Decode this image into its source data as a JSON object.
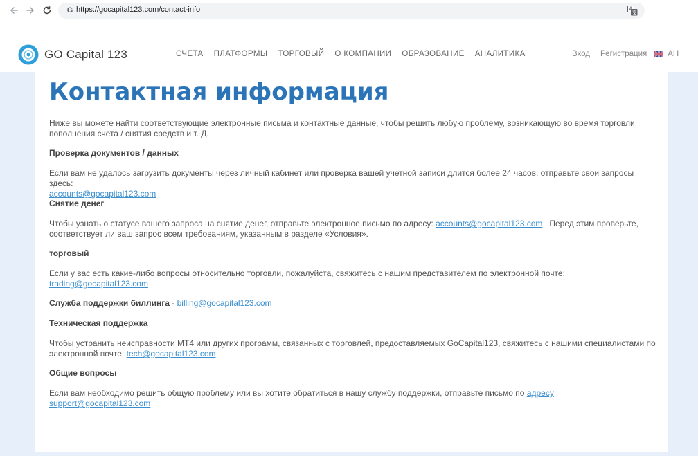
{
  "browser": {
    "url": "https://gocapital123.com/contact-info",
    "favicon_letter": "G"
  },
  "header": {
    "brand": "GO Capital 123",
    "nav": [
      "СЧЕТА",
      "ПЛАТФОРМЫ",
      "ТОРГОВЫЙ",
      "О КОМПАНИИ",
      "ОБРАЗОВАНИЕ",
      "АНАЛИТИКА"
    ],
    "login": "Вход",
    "register": "Регистрация",
    "language": "АН"
  },
  "content": {
    "title": "Контактная информация",
    "intro": "Ниже вы можете найти соответствующие электронные письма и контактные данные, чтобы решить любую проблему, возникающую во время торговли пополнения счета / снятия средств и т. Д.",
    "sections": [
      {
        "heading": "Проверка документов / данных",
        "text": "Если вам не удалось загрузить документы через личный кабинет или проверка вашей учетной записи длится более 24 часов, отправьте свои запросы здесь:",
        "email": "accounts@gocapital123.com"
      },
      {
        "heading": "Снятие денег",
        "text_before": "Чтобы узнать о статусе вашего запроса на снятие денег, отправьте электронное письмо по адресу:",
        "email": "accounts@gocapital123.com",
        "text_after": ". Перед этим проверьте, соответствует ли ваш запрос всем требованиям, указанным в разделе «Условия»."
      },
      {
        "heading": "торговый",
        "text": "Если у вас есть какие-либо вопросы относительно торговли, пожалуйста, свяжитесь с нашим представителем по электронной почте:",
        "email": "trading@gocapital123.com"
      },
      {
        "heading": "Служба поддержки биллинга",
        "separator": "-",
        "email": "billing@gocapital123.com"
      },
      {
        "heading": "Техническая поддержка",
        "text": "Чтобы устранить неисправности МТ4 или других программ, связанных с торговлей, предоставляемых GoCapital123, свяжитесь с нашими специалистами по электронной почте:",
        "email": "tech@gocapital123.com"
      },
      {
        "heading": "Общие вопросы",
        "text": "Если вам необходимо решить общую проблему или вы хотите обратиться в нашу службу поддержки, отправьте письмо по",
        "email_prefix": "адресу",
        "email": "support@gocapital123.com"
      }
    ]
  },
  "colors": {
    "title_blue": "#2a74b7",
    "link_blue": "#3a8fd0",
    "page_bg": "#e7f0fa",
    "logo_ring": "#2e9fd8"
  }
}
